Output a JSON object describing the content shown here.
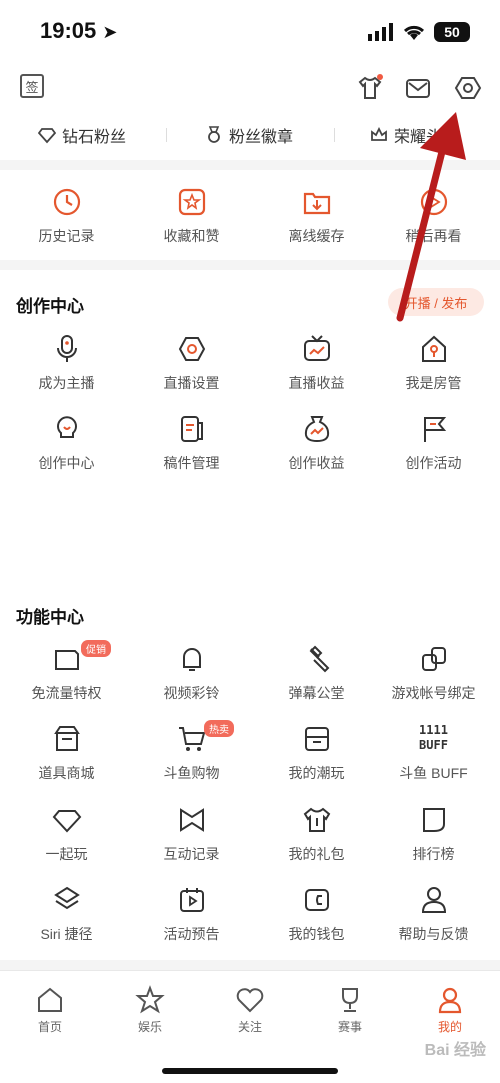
{
  "status": {
    "time": "19:05",
    "battery": "50"
  },
  "header": {
    "fans": [
      {
        "label": "钻石粉丝",
        "icon": "diamond-icon"
      },
      {
        "label": "粉丝徽章",
        "icon": "medal-icon"
      },
      {
        "label": "荣耀头",
        "icon": "crown-icon"
      }
    ],
    "signin_icon": "签"
  },
  "quick": [
    {
      "label": "历史记录",
      "icon": "clock-icon"
    },
    {
      "label": "收藏和赞",
      "icon": "star-icon"
    },
    {
      "label": "离线缓存",
      "icon": "download-folder-icon"
    },
    {
      "label": "稍后再看",
      "icon": "play-later-icon"
    }
  ],
  "creation": {
    "title": "创作中心",
    "action": "开播 / 发布",
    "items": [
      {
        "label": "成为主播",
        "icon": "microphone-icon"
      },
      {
        "label": "直播设置",
        "icon": "settings-hex-icon"
      },
      {
        "label": "直播收益",
        "icon": "tv-icon"
      },
      {
        "label": "我是房管",
        "icon": "house-icon"
      },
      {
        "label": "创作中心",
        "icon": "bulb-icon"
      },
      {
        "label": "稿件管理",
        "icon": "manuscript-icon"
      },
      {
        "label": "创作收益",
        "icon": "money-bag-icon"
      },
      {
        "label": "创作活动",
        "icon": "flag-icon"
      }
    ]
  },
  "features": {
    "title": "功能中心",
    "items": [
      {
        "label": "免流量特权",
        "icon": "sim-card-icon",
        "badge": "促销"
      },
      {
        "label": "视频彩铃",
        "icon": "bell-icon",
        "badge": ""
      },
      {
        "label": "弹幕公堂",
        "icon": "gavel-icon",
        "badge": ""
      },
      {
        "label": "游戏帐号绑定",
        "icon": "link-icon",
        "badge": ""
      },
      {
        "label": "道具商城",
        "icon": "shop-icon",
        "badge": ""
      },
      {
        "label": "斗鱼购物",
        "icon": "cart-icon",
        "badge": "热卖"
      },
      {
        "label": "我的潮玩",
        "icon": "box-icon",
        "badge": ""
      },
      {
        "label": "斗鱼 BUFF",
        "icon": "buff-icon",
        "badge": ""
      },
      {
        "label": "一起玩",
        "icon": "diamond-outline-icon",
        "badge": ""
      },
      {
        "label": "互动记录",
        "icon": "bowtie-icon",
        "badge": ""
      },
      {
        "label": "我的礼包",
        "icon": "shirt-gift-icon",
        "badge": ""
      },
      {
        "label": "排行榜",
        "icon": "ranking-icon",
        "badge": ""
      },
      {
        "label": "Siri 捷径",
        "icon": "layers-icon",
        "badge": ""
      },
      {
        "label": "活动预告",
        "icon": "calendar-play-icon",
        "badge": ""
      },
      {
        "label": "我的钱包",
        "icon": "wallet-icon",
        "badge": ""
      },
      {
        "label": "帮助与反馈",
        "icon": "person-icon",
        "badge": ""
      }
    ]
  },
  "buff_text": "1111 BUFF",
  "tabs": [
    {
      "label": "首页",
      "icon": "home-icon"
    },
    {
      "label": "娱乐",
      "icon": "star-tab-icon"
    },
    {
      "label": "关注",
      "icon": "heart-icon"
    },
    {
      "label": "赛事",
      "icon": "trophy-icon"
    },
    {
      "label": "我的",
      "icon": "profile-icon"
    }
  ],
  "watermark": "Bai 经验",
  "colors": {
    "accent": "#e4572e",
    "arrow": "#b81c1c"
  }
}
